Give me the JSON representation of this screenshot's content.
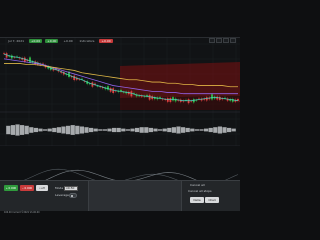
{
  "header": {
    "symbol": "Jul 7, 2021",
    "pill_1": "+0.00",
    "pill_2": "+0.00",
    "pill_3": "+0.00",
    "pill_4": "Indicators",
    "pill_5": "+0.00"
  },
  "bottom": {
    "btn_buy": "+ 0.000",
    "btn_sell": "− 0.000",
    "btn_mode": "• off",
    "label_mode": "Mode",
    "input_mode": "x0.50",
    "label_tp": "Leverage",
    "label_right_1": "Cancel all",
    "label_right_2": "Cancel all stops",
    "btn_right_a": "Delta",
    "btn_right_b": "Chart"
  },
  "footer": {
    "text": "100.00 Current ©2021 V1.00.00"
  },
  "colors": {
    "bg": "#111315",
    "grid": "#2a2e33",
    "bull": "#2fbf48",
    "bear": "#e34040",
    "ma1": "#9b6cff",
    "ma2": "#4dd4c2",
    "ma3": "#f2c84b"
  },
  "chart_data": {
    "type": "line",
    "x": [
      0,
      1,
      2,
      3,
      4,
      5,
      6,
      7,
      8,
      9,
      10,
      11,
      12,
      13,
      14,
      15,
      16,
      17,
      18,
      19,
      20,
      21,
      22,
      23,
      24,
      25,
      26,
      27,
      28,
      29,
      30
    ],
    "series": [
      {
        "name": "",
        "values": [
          78,
          76,
          75,
          73,
          71,
          69,
          66,
          64,
          61,
          58,
          56,
          53,
          51,
          49,
          47,
          46,
          45,
          43,
          42,
          41,
          40,
          39,
          39,
          38,
          38,
          39,
          40,
          41,
          40,
          39,
          38
        ]
      },
      {
        "name": "",
        "values": [
          74,
          73,
          72,
          71,
          70,
          69,
          67,
          65,
          63,
          61,
          59,
          57,
          55,
          53,
          51,
          50,
          49,
          48,
          47,
          46,
          46,
          45,
          45,
          44,
          44,
          44,
          44,
          44,
          44,
          44,
          44
        ]
      },
      {
        "name": "",
        "values": [
          70,
          70,
          70,
          69,
          69,
          68,
          67,
          66,
          65,
          64,
          62,
          61,
          60,
          59,
          58,
          57,
          56,
          56,
          55,
          54,
          54,
          53,
          53,
          52,
          52,
          51,
          51,
          51,
          51,
          50,
          50
        ]
      }
    ],
    "xlim": [
      0,
      30
    ],
    "ylim": [
      30,
      85
    ]
  },
  "indicator": {
    "bars": [
      0.6,
      0.7,
      0.8,
      0.7,
      0.6,
      0.4,
      0.3,
      0.2,
      0.1,
      0.2,
      0.3,
      0.4,
      0.5,
      0.6,
      0.7,
      0.6,
      0.5,
      0.4,
      0.3,
      0.2,
      0.1,
      0.1,
      0.2,
      0.3,
      0.3,
      0.2,
      0.1,
      0.2,
      0.3,
      0.4,
      0.4,
      0.3,
      0.2,
      0.1,
      0.2,
      0.3,
      0.4,
      0.5,
      0.4,
      0.3,
      0.2,
      0.1,
      0.1,
      0.2,
      0.3,
      0.4,
      0.5,
      0.4,
      0.3,
      0.2
    ]
  }
}
